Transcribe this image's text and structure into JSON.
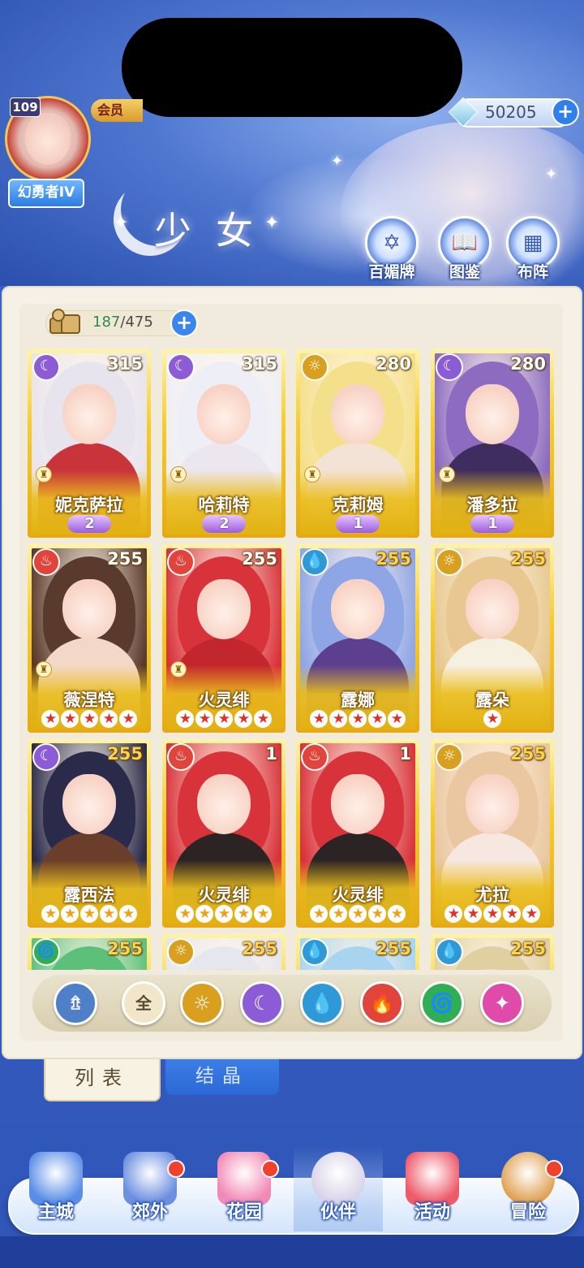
{
  "header": {
    "level": "109",
    "vip_label": "会员",
    "rank_title": "幻勇者IV",
    "gem_count": "50205",
    "page_title": "少女",
    "buttons": [
      {
        "label": "百媚牌",
        "icon": "star-seal-icon"
      },
      {
        "label": "图鉴",
        "icon": "book-icon"
      },
      {
        "label": "布阵",
        "icon": "grid-formation-icon"
      }
    ]
  },
  "roster": {
    "count_current": "187",
    "count_sep": "/",
    "count_max": "475"
  },
  "cards": [
    {
      "name": "妮克萨拉",
      "level": "315",
      "element": "moon",
      "elem_color": "#8b5cd6",
      "badge": "2",
      "badge_type": "wing",
      "rook": true,
      "hair": "#e8e4ee",
      "outfit": "#c8343a",
      "lvl_gold": false
    },
    {
      "name": "哈莉特",
      "level": "315",
      "element": "moon",
      "elem_color": "#8b5cd6",
      "badge": "2",
      "badge_type": "wing",
      "rook": true,
      "hair": "#eeeef6",
      "outfit": "#ece6ee",
      "lvl_gold": false
    },
    {
      "name": "克莉姆",
      "level": "280",
      "element": "sun",
      "elem_color": "#d9a020",
      "badge": "1",
      "badge_type": "wing",
      "rook": true,
      "hair": "#f4df8a",
      "outfit": "#f3e2d6",
      "lvl_gold": false
    },
    {
      "name": "潘多拉",
      "level": "280",
      "element": "moon",
      "elem_color": "#8b5cd6",
      "badge": "1",
      "badge_type": "wing",
      "rook": true,
      "hair": "#8c6bc0",
      "outfit": "#3e2d5e",
      "lvl_gold": false
    },
    {
      "name": "薇涅特",
      "level": "255",
      "element": "fire",
      "elem_color": "#e0443a",
      "stars": 5,
      "star_color": "red",
      "rook": true,
      "hair": "#5a3a2c",
      "outfit": "#f3d8c8",
      "lvl_gold": false
    },
    {
      "name": "火灵绯",
      "level": "255",
      "element": "fire",
      "elem_color": "#e0443a",
      "stars": 5,
      "star_color": "red",
      "rook": true,
      "hair": "#d8323a",
      "outfit": "#c3272e",
      "lvl_gold": false
    },
    {
      "name": "露娜",
      "level": "255",
      "element": "water",
      "elem_color": "#2f98d6",
      "stars": 5,
      "star_color": "red",
      "rook": false,
      "hair": "#8fa6e6",
      "outfit": "#5c3f8e",
      "lvl_gold": true
    },
    {
      "name": "露朵",
      "level": "255",
      "element": "sun",
      "elem_color": "#d9a020",
      "stars": 1,
      "star_color": "red",
      "rook": false,
      "hair": "#e8c890",
      "outfit": "#f6f0e0",
      "lvl_gold": true
    },
    {
      "name": "露西法",
      "level": "255",
      "element": "moon",
      "elem_color": "#8b5cd6",
      "stars": 5,
      "star_color": "gold",
      "rook": false,
      "hair": "#2a2a4a",
      "outfit": "#6a3e2a",
      "lvl_gold": true
    },
    {
      "name": "火灵绯",
      "level": "1",
      "element": "fire",
      "elem_color": "#e0443a",
      "stars": 5,
      "star_color": "gold",
      "rook": false,
      "hair": "#d8323a",
      "outfit": "#2c2424",
      "lvl_gold": false
    },
    {
      "name": "火灵绯",
      "level": "1",
      "element": "fire",
      "elem_color": "#e0443a",
      "stars": 5,
      "star_color": "gold",
      "rook": false,
      "hair": "#d8323a",
      "outfit": "#2c2424",
      "lvl_gold": false
    },
    {
      "name": "尤拉",
      "level": "255",
      "element": "sun",
      "elem_color": "#d9a020",
      "stars": 5,
      "star_color": "red",
      "rook": false,
      "hair": "#eac7a0",
      "outfit": "#f6e8e0",
      "lvl_gold": true
    },
    {
      "name": "",
      "level": "255",
      "element": "wind",
      "elem_color": "#2fae52",
      "stars": 0,
      "rook": false,
      "hair": "#5cc07a",
      "outfit": "#f0e0c0",
      "lvl_gold": true
    },
    {
      "name": "",
      "level": "255",
      "element": "sun",
      "elem_color": "#d9a020",
      "stars": 0,
      "rook": false,
      "hair": "#e6e6ef",
      "outfit": "#f0e0d0",
      "lvl_gold": true
    },
    {
      "name": "",
      "level": "255",
      "element": "water",
      "elem_color": "#2f98d6",
      "stars": 0,
      "rook": false,
      "hair": "#a8d4f0",
      "outfit": "#f0e0d0",
      "lvl_gold": true
    },
    {
      "name": "",
      "level": "255",
      "element": "water",
      "elem_color": "#2f98d6",
      "stars": 0,
      "rook": false,
      "hair": "#e0cfa0",
      "outfit": "#f0e0d0",
      "lvl_gold": true
    }
  ],
  "filters": [
    {
      "id": "class",
      "label": "",
      "icon": "class-filter-icon",
      "color": "#4f7fc8",
      "glyph": "⇯"
    },
    {
      "id": "all",
      "label": "全",
      "icon": "all-filter-icon",
      "color": "#f1e6c8",
      "glyph": "全"
    },
    {
      "id": "sun",
      "label": "",
      "icon": "sun-element-icon",
      "color": "#d9a020",
      "glyph": "☼"
    },
    {
      "id": "moon",
      "label": "",
      "icon": "moon-element-icon",
      "color": "#8b5cd6",
      "glyph": "☾"
    },
    {
      "id": "water",
      "label": "",
      "icon": "water-element-icon",
      "color": "#2f98d6",
      "glyph": "💧"
    },
    {
      "id": "fire",
      "label": "",
      "icon": "fire-element-icon",
      "color": "#e0443a",
      "glyph": "🔥"
    },
    {
      "id": "wind",
      "label": "",
      "icon": "wind-element-icon",
      "color": "#2fae52",
      "glyph": "🌀"
    },
    {
      "id": "star",
      "label": "",
      "icon": "star-element-icon",
      "color": "#e04aa8",
      "glyph": "✦"
    }
  ],
  "tabs": {
    "list": "列表",
    "crystal": "结晶"
  },
  "nav": [
    {
      "label": "主城",
      "icon": "castle-icon",
      "color": "#5a8ee6",
      "dot": false,
      "active": false
    },
    {
      "label": "郊外",
      "icon": "magic-circle-icon",
      "color": "#6c8fe0",
      "dot": true,
      "active": false
    },
    {
      "label": "花园",
      "icon": "heart-garden-icon",
      "color": "#f28ab6",
      "dot": true,
      "active": false
    },
    {
      "label": "伙伴",
      "icon": "partner-portrait-icon",
      "color": "#d8d2e8",
      "dot": false,
      "active": true
    },
    {
      "label": "活动",
      "icon": "gift-box-icon",
      "color": "#ee5a6a",
      "dot": false,
      "active": false
    },
    {
      "label": "冒险",
      "icon": "compass-icon",
      "color": "#e0a050",
      "dot": true,
      "active": false
    }
  ]
}
